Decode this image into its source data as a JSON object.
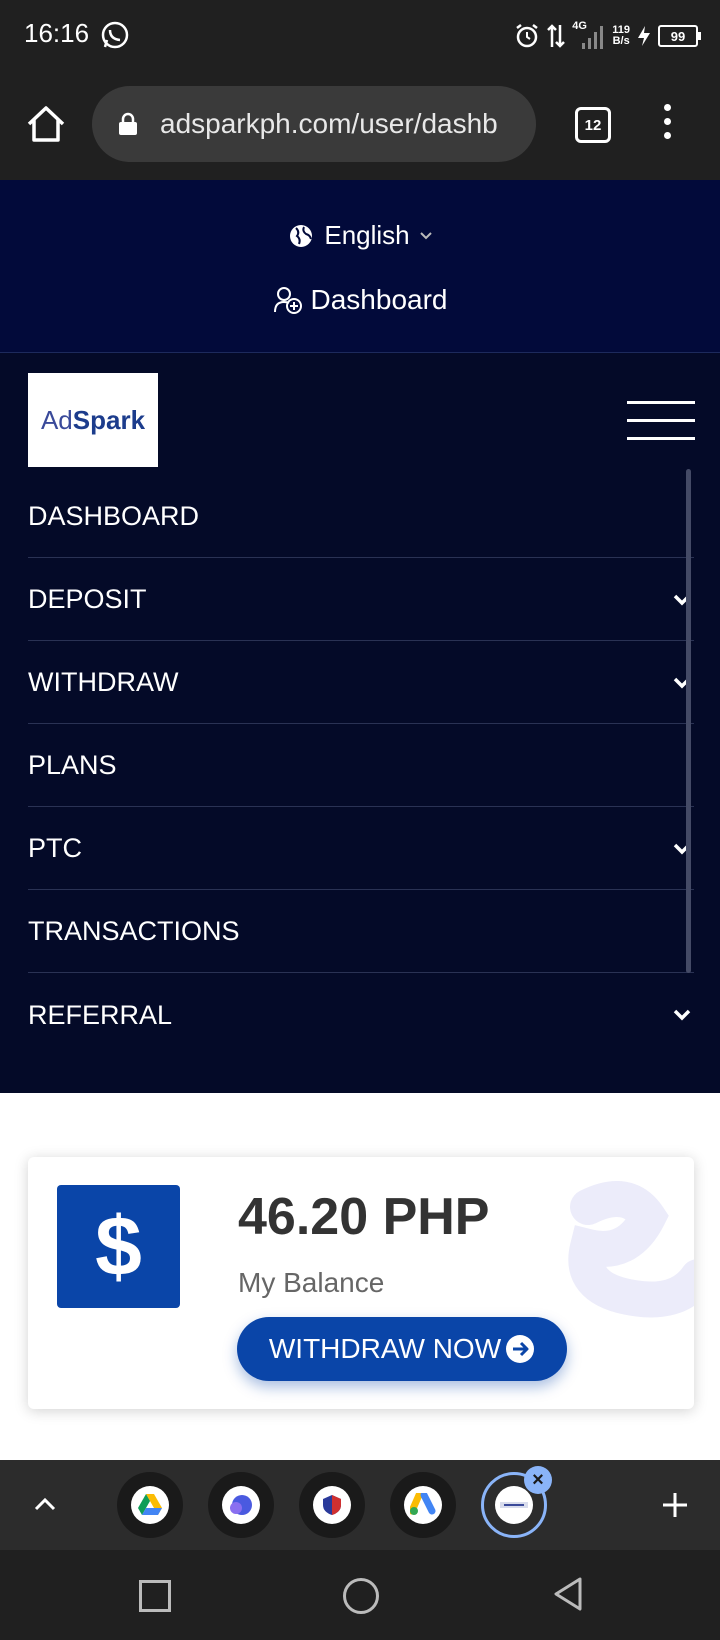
{
  "status_bar": {
    "time": "16:16",
    "network_type": "4G",
    "speed_value": "119",
    "speed_unit": "B/s",
    "battery": "99"
  },
  "browser": {
    "url": "adsparkph.com/user/dashb",
    "tab_count": "12"
  },
  "site_header": {
    "language": "English",
    "dashboard_link": "Dashboard"
  },
  "logo": {
    "part1": "Ad",
    "part2": "Spark"
  },
  "nav": {
    "items": [
      {
        "label": "DASHBOARD",
        "has_submenu": false
      },
      {
        "label": "DEPOSIT",
        "has_submenu": true
      },
      {
        "label": "WITHDRAW",
        "has_submenu": true
      },
      {
        "label": "PLANS",
        "has_submenu": false
      },
      {
        "label": "PTC",
        "has_submenu": true
      },
      {
        "label": "TRANSACTIONS",
        "has_submenu": false
      },
      {
        "label": "REFERRAL",
        "has_submenu": true
      }
    ]
  },
  "balance_card": {
    "icon_glyph": "$",
    "amount": "46.20 PHP",
    "label": "My Balance",
    "button_label": "WITHDRAW NOW"
  },
  "colors": {
    "header_bg": "#020a3a",
    "nav_bg": "#040a28",
    "accent_blue": "#0a45a8",
    "tab_highlight": "#8ab4f8"
  },
  "tab_group": {
    "tabs": [
      "google-drive",
      "chat-app",
      "shield-app",
      "google-ads",
      "adspark"
    ],
    "active_index": 4
  }
}
